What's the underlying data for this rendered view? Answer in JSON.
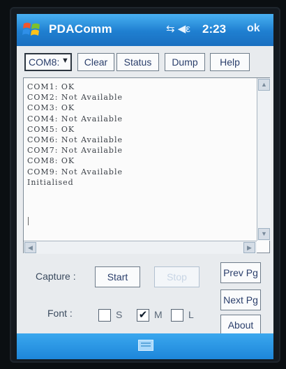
{
  "titlebar": {
    "app_title": "PDAComm",
    "status_icons": "⇆ ◀ε",
    "clock": "2:23",
    "ok_label": "ok"
  },
  "toolbar": {
    "port_selected": "COM8:",
    "clear_label": "Clear",
    "status_label": "Status",
    "dump_label": "Dump",
    "help_label": "Help"
  },
  "output": {
    "lines": [
      "COM1: OK",
      "COM2: Not Available",
      "COM3: OK",
      "COM4: Not Available",
      "COM5: OK",
      "COM6: Not Available",
      "COM7: Not Available",
      "COM8: OK",
      "COM9: Not Available",
      "Initialised"
    ]
  },
  "capture": {
    "label": "Capture :",
    "start_label": "Start",
    "stop_label": "Stop"
  },
  "font": {
    "label": "Font :",
    "options": [
      {
        "label": "S",
        "checked": false
      },
      {
        "label": "M",
        "checked": true
      },
      {
        "label": "L",
        "checked": false
      }
    ]
  },
  "nav": {
    "prev_label": "Prev Pg",
    "next_label": "Next Pg",
    "about_label": "About"
  },
  "colors": {
    "titlebar": "#2a8ee0",
    "button_text": "#2a3e6b",
    "screen_bg": "#e8ebee"
  }
}
